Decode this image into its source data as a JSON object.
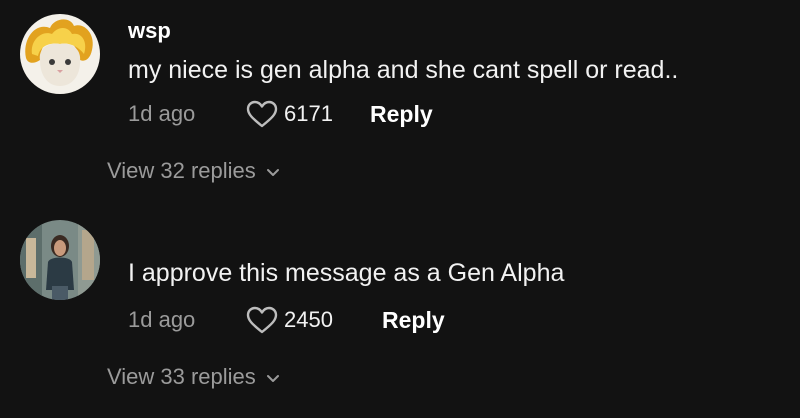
{
  "comments": [
    {
      "username": "wsp",
      "text": "my niece is gen alpha and she cant spell or read..",
      "time": "1d ago",
      "likes": "6171",
      "reply_label": "Reply",
      "view_replies": "View 32 replies",
      "avatar_icon": "flaming-cat-avatar"
    },
    {
      "username": "",
      "text": "I approve this message as a Gen Alpha",
      "time": "1d ago",
      "likes": "2450",
      "reply_label": "Reply",
      "view_replies": "View 33 replies",
      "avatar_icon": "person-photo-avatar"
    }
  ],
  "icons": {
    "like": "heart-outline-icon",
    "expand": "chevron-down-icon"
  },
  "colors": {
    "background": "#121212",
    "primary_text": "#f2f2f2",
    "secondary_text": "#9b9b9b"
  }
}
